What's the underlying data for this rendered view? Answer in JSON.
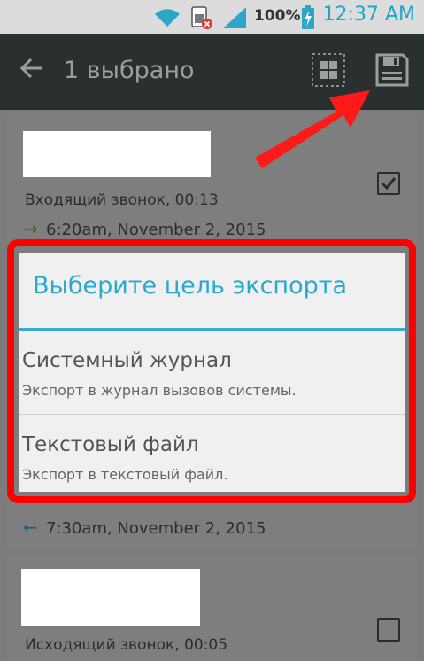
{
  "status_bar": {
    "battery_percent": "100%",
    "time": "12:37 AM",
    "icons": [
      "wifi-icon",
      "sim-error-icon",
      "signal-icon",
      "battery-charging-icon"
    ]
  },
  "action_bar": {
    "title": "1 выбрано",
    "back_icon": "back-arrow-icon",
    "select_all_icon": "select-all-icon",
    "save_icon": "save-icon"
  },
  "list": {
    "items": [
      {
        "call_type": "Входящий звонок, 00:13",
        "date": "6:20am, November 2, 2015",
        "direction": "incoming",
        "checked": true
      },
      {
        "date": "7:30am, November 2, 2015",
        "direction": "outgoing"
      },
      {
        "call_type": "Исходящий звонок, 00:05",
        "checked": false
      }
    ]
  },
  "dialog": {
    "title": "Выберите цель экспорта",
    "options": [
      {
        "title": "Системный журнал",
        "subtitle": "Экспорт в журнал вызовов системы."
      },
      {
        "title": "Текстовый файл",
        "subtitle": "Экспорт в текстовый файл."
      }
    ]
  },
  "annotation": {
    "highlight_color": "#ff0000"
  }
}
